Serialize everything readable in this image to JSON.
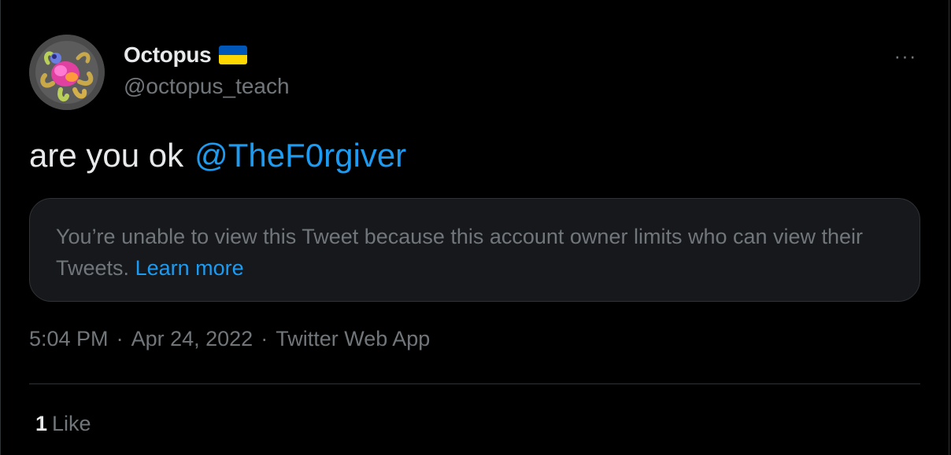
{
  "tweet": {
    "author": {
      "display_name": "Octopus",
      "handle": "@octopus_teach",
      "flag_colors": [
        "#0057b7",
        "#ffd700"
      ]
    },
    "more_icon": "ellipsis-icon",
    "more_glyph": "···",
    "text": "are you ok",
    "mention": "@TheF0rgiver",
    "quoted_notice": {
      "message": "You’re unable to view this Tweet because this account owner limits who can view their Tweets.",
      "link_label": "Learn more"
    },
    "time": "5:04 PM",
    "separator": "·",
    "date": "Apr 24, 2022",
    "source": "Twitter Web App",
    "likes": {
      "count": "1",
      "label": "Like"
    }
  },
  "colors": {
    "background": "#000000",
    "text": "#e7e9ea",
    "muted": "#71767b",
    "link": "#1d9bf0",
    "card_bg": "#16181c",
    "border": "#2f3336"
  }
}
